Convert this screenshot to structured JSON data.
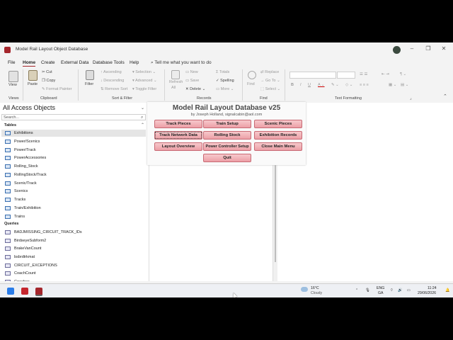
{
  "window": {
    "title": "Model Rail Layout Object Database"
  },
  "menu": {
    "tabs": [
      "File",
      "Home",
      "Create",
      "External Data",
      "Database Tools",
      "Help"
    ],
    "active": "Home",
    "tell_me": "Tell me what you want to do"
  },
  "ribbon": {
    "views": {
      "view": "View",
      "group": "Views"
    },
    "clipboard": {
      "paste": "Paste",
      "cut": "Cut",
      "copy": "Copy",
      "format_painter": "Format Painter",
      "group": "Clipboard"
    },
    "sort_filter": {
      "filter": "Filter",
      "ascending": "Ascending",
      "descending": "Descending",
      "remove_sort": "Remove Sort",
      "selection": "Selection",
      "advanced": "Advanced",
      "toggle_filter": "Toggle Filter",
      "group": "Sort & Filter"
    },
    "records": {
      "refresh": "Refresh",
      "all": "All",
      "new": "New",
      "save": "Save",
      "delete": "Delete",
      "totals": "Totals",
      "spelling": "Spelling",
      "more": "More",
      "group": "Records"
    },
    "find": {
      "find": "Find",
      "replace": "Replace",
      "goto": "Go To",
      "select": "Select",
      "group": "Find"
    },
    "text_formatting": {
      "group": "Text Formatting"
    }
  },
  "nav": {
    "title": "All Access Objects",
    "search_placeholder": "Search...",
    "tables_header": "Tables",
    "tables": [
      "Exhibitions",
      "Power/Scenics",
      "Power/Track",
      "PowerAccessories",
      "Rolling_Stock",
      "RollingStock/Track",
      "Scenic/Track",
      "Scenics",
      "Tracks",
      "Train/Exhibition",
      "Trains"
    ],
    "queries_header": "Queries",
    "queries": [
      "BADJMISSING_CIRCUIT_TRACK_IDs",
      "BirdseyeSubform2",
      "BrakeVanCount",
      "bsbrdtrkmat",
      "CIRCUIT_EXCEPTIONS",
      "CoachCount",
      "Coaches"
    ]
  },
  "form": {
    "title": "Model Rail Layout Database v25",
    "subtitle": "by Joseph Holland, signalcabin@aol.com",
    "buttons": {
      "track_pieces": "Track Pieces",
      "train_setup": "Train Setup",
      "scenic_pieces": "Scenic Pieces",
      "track_network": "Track Network Data",
      "rolling_stock": "Rolling Stock",
      "exhibition_records": "Exhibition Records",
      "layout_overview": "Layout Overview",
      "power_controller": "Power Controller Setup",
      "close_menu": "Close Main Menu",
      "quit": "Quit"
    }
  },
  "taskbar": {
    "weather_temp": "16°C",
    "weather_desc": "Cloudy",
    "lang_top": "ENG",
    "lang_bottom": "GA",
    "time": "11:24",
    "date": "29/06/2026"
  },
  "colors": {
    "accent": "#a4262c",
    "button_fill": "#ec9fa6",
    "button_border": "#c86a74"
  }
}
